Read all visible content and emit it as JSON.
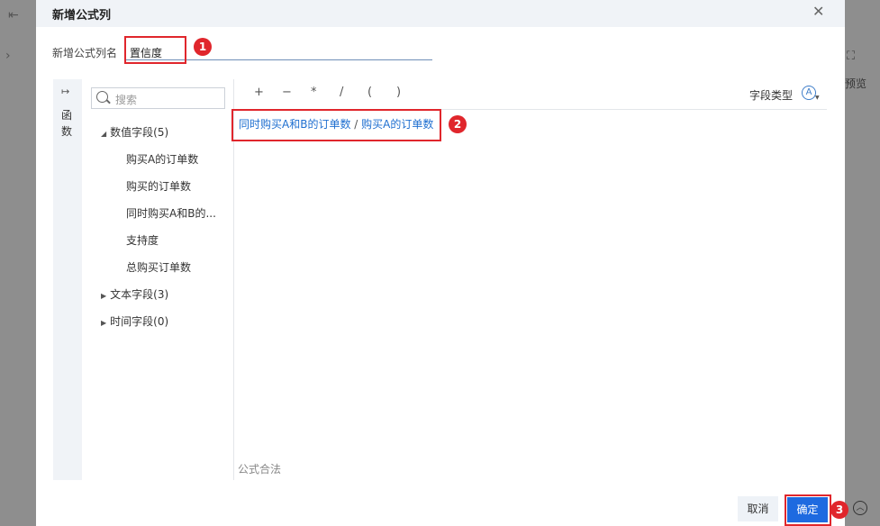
{
  "background": {
    "right_label": "预览"
  },
  "dialog": {
    "title": "新增公式列",
    "name_label": "新增公式列名",
    "name_value": "置信度"
  },
  "sidebar": {
    "function_tab": "函数"
  },
  "field_tree": {
    "search_placeholder": "搜索",
    "groups": [
      {
        "label": "数值字段(5)",
        "expanded": true,
        "items": [
          "购买A的订单数",
          "购买的订单数",
          "同时购买A和B的...",
          "支持度",
          "总购买订单数"
        ]
      },
      {
        "label": "文本字段(3)",
        "expanded": false
      },
      {
        "label": "时间字段(0)",
        "expanded": false
      }
    ]
  },
  "editor": {
    "operators": [
      "+",
      "−",
      "*",
      "/",
      "(",
      ")"
    ],
    "field_type_label": "字段类型",
    "field_type_icon": "A",
    "formula_left": "同时购买A和B的订单数",
    "formula_op": "/",
    "formula_right": "购买A的订单数",
    "status": "公式合法"
  },
  "footer": {
    "cancel": "取消",
    "confirm": "确定"
  },
  "annotations": [
    "1",
    "2",
    "3"
  ],
  "colors": {
    "accent": "#1e6ae0",
    "callout": "#e0262c",
    "overlay": "#8c8c8c"
  }
}
